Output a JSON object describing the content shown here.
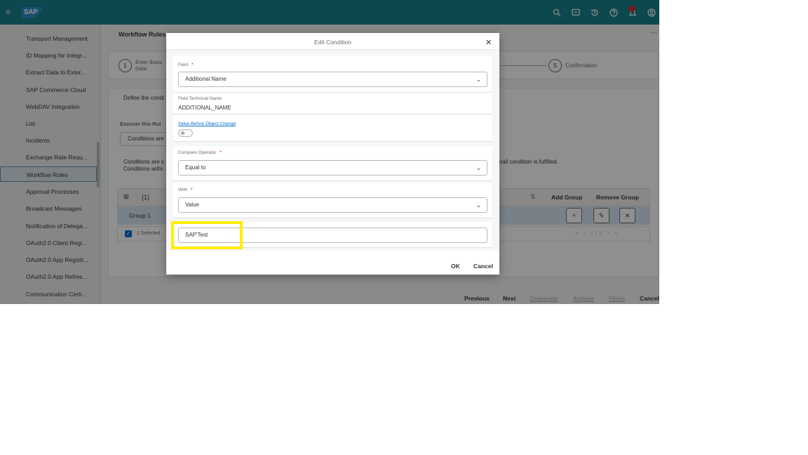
{
  "shell": {
    "menu_icon": "hamburger-icon",
    "logo": "SAP",
    "icons": [
      "search-icon",
      "feedback-icon",
      "history-icon",
      "help-icon",
      "notifications-icon",
      "user-icon"
    ]
  },
  "sidebar": {
    "items": [
      {
        "label": "Transport Management"
      },
      {
        "label": "ID Mapping for Integr..."
      },
      {
        "label": "Extract Data to Exter..."
      },
      {
        "label": "SAP Commerce Cloud"
      },
      {
        "label": "WebDAV Integration"
      },
      {
        "label": "List"
      },
      {
        "label": "Incidents"
      },
      {
        "label": "Exchange Rate Requ..."
      },
      {
        "label": "Workflow Rules",
        "active": true
      },
      {
        "label": "Approval Processes"
      },
      {
        "label": "Broadcast Messages"
      },
      {
        "label": "Notification of Delega..."
      },
      {
        "label": "OAuth2.0 Client Regi..."
      },
      {
        "label": "OAuth2.0 App Registr..."
      },
      {
        "label": "OAuth2.0 App Refres..."
      },
      {
        "label": "Communication Certi..."
      }
    ]
  },
  "page": {
    "title": "Workflow Rules",
    "more": "···",
    "step1_number": "1",
    "step1_label": "Enter Basic Data",
    "step5_number": "5",
    "step5_label": "Confirmation",
    "define_text": "Define the condi",
    "execute_label": "Execute this Rul",
    "execute_value": "Conditions are",
    "conditions_line1": "Conditions are s",
    "conditions_line2": "Conditions withi",
    "overall_text": "erall condition is fulfilled.",
    "table_count": "(1)",
    "add_group": "Add Group",
    "remove_group": "Remove Group",
    "group_label": "Group 1",
    "selected_text": "1 Selected",
    "pager": "/1"
  },
  "footer": {
    "previous": "Previous",
    "next": "Next",
    "deactivate": "Deactivate",
    "activate": "Activate",
    "finish": "Finish",
    "cancel": "Cancel"
  },
  "dialog": {
    "title": "Edit Condition",
    "field_label": "Field",
    "field_value": "Additional Name",
    "tech_label": "Field Technical Name",
    "tech_value": "ADDITIONAL_NAME",
    "before_change_label": "Value Before Object Change",
    "compare_label": "Compare Operator",
    "compare_value": "Equal to",
    "with_label": "With",
    "with_value": "Value",
    "value_input": "SAP'Test",
    "required_mark": "*",
    "ok": "OK",
    "cancel": "Cancel"
  },
  "colors": {
    "shell_bar": "#17808a",
    "highlight": "#ffee00",
    "accent": "#0a6ed1"
  }
}
